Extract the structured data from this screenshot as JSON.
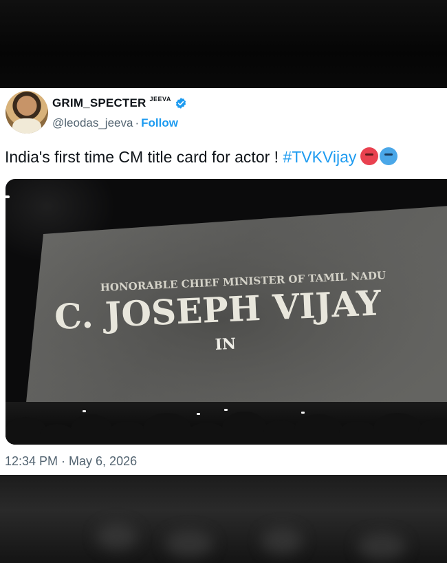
{
  "tweet": {
    "display_name": "GRIM_SPECTER",
    "name_superscript": "JEEVA",
    "handle": "@leodas_jeeva",
    "separator": "·",
    "follow_label": "Follow",
    "text_main": "India's first time CM title card for actor ! ",
    "hashtag": "#TVKVijay",
    "emojis": [
      "hot-face-emoji",
      "cold-face-emoji"
    ],
    "timestamp": "12:34 PM · May 6, 2026"
  },
  "media": {
    "title_line1": "HONORABLE CHIEF MINISTER OF TAMIL NADU",
    "title_line2": "C. JOSEPH VIJAY",
    "title_line3": "IN"
  },
  "colors": {
    "accent": "#1d9bf0",
    "verified": "#1d9bf0",
    "text": "#0f1419",
    "secondary": "#536471",
    "screen": "#5a5a58"
  },
  "icons": {
    "verified": "verified-badge-icon",
    "avatar": "profile-avatar"
  }
}
